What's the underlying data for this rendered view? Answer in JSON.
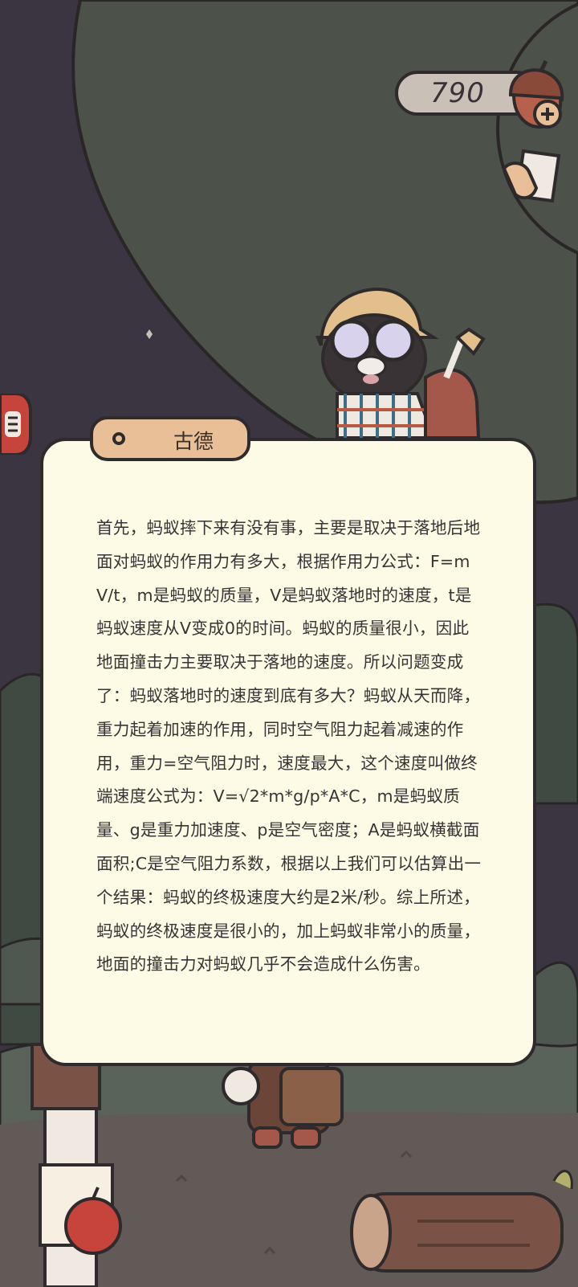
{
  "hud": {
    "currency_value": "790",
    "currency_icon": "acorn-plus-icon",
    "note_icon": "paper-note-icon",
    "side_tab_icon": "side-menu-icon"
  },
  "dialog": {
    "speaker": "古德",
    "text": "首先，蚂蚁摔下来有没有事，主要是取决于落地后地面对蚂蚁的作用力有多大，根据作用力公式：F=mV/t，m是蚂蚁的质量，V是蚂蚁落地时的速度，t是蚂蚁速度从V变成0的时间。蚂蚁的质量很小，因此地面撞击力主要取决于落地的速度。所以问题变成了：蚂蚁落地时的速度到底有多大？蚂蚁从天而降，重力起着加速的作用，同时空气阻力起着减速的作用，重力=空气阻力时，速度最大，这个速度叫做终端速度公式为：V=√2*m*g/p*A*C，m是蚂蚁质量、g是重力加速度、p是空气密度；A是蚂蚁横截面面积;C是空气阻力系数，根据以上我们可以估算出一个结果：蚂蚁的终极速度大约是2米/秒。综上所述，蚂蚁的终极速度是很小的，加上蚂蚁非常小的质量，地面的撞击力对蚂蚁几乎不会造成什么伤害。"
  },
  "colors": {
    "background": "#3a3540",
    "tree": "#4c5249",
    "dialog_bg": "#fdfae5",
    "name_tag_bg": "#e8bf97",
    "outline": "#2f2a2c"
  }
}
